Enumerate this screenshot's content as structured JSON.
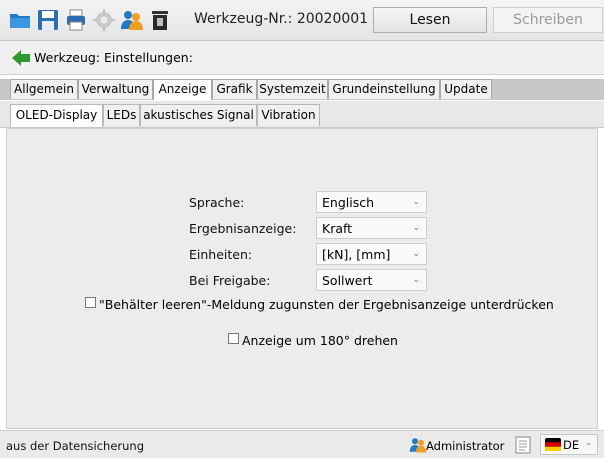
{
  "toolbar": {
    "tool_number_label": "Werkzeug-Nr.: 20020001",
    "read_label": "Lesen",
    "write_label": "Schreiben",
    "icons": [
      "folder-open-icon",
      "save-icon",
      "print-icon",
      "settings-gear-icon",
      "users-icon",
      "trash-icon"
    ]
  },
  "breadcrumb": {
    "text": "Werkzeug: Einstellungen:"
  },
  "tabs": [
    "Allgemein",
    "Verwaltung",
    "Anzeige",
    "Grafik",
    "Systemzeit",
    "Grundeinstellung",
    "Update"
  ],
  "tabs_active": "Anzeige",
  "subtabs": [
    "OLED-Display",
    "LEDs",
    "akustisches Signal",
    "Vibration"
  ],
  "subtabs_active": "OLED-Display",
  "form": {
    "language_label": "Sprache:",
    "language_value": "Englisch",
    "result_label": "Ergebnisanzeige:",
    "result_value": "Kraft",
    "units_label": "Einheiten:",
    "units_value": "[kN], [mm]",
    "release_label": "Bei Freigabe:",
    "release_value": "Sollwert",
    "suppress_label": "\"Behälter leeren\"-Meldung zugunsten der Ergebnisanzeige unterdrücken",
    "suppress_checked": false,
    "rotate_label": "Anzeige um 180° drehen",
    "rotate_checked": false
  },
  "status": {
    "message": "aus der Datensicherung",
    "user": "Administrator",
    "language": "DE"
  },
  "colors": {
    "accent_green": "#2e9b2e",
    "folder_blue": "#1f7ac8",
    "flag_black": "#000000",
    "flag_red": "#dd0000",
    "flag_gold": "#ffce00"
  }
}
